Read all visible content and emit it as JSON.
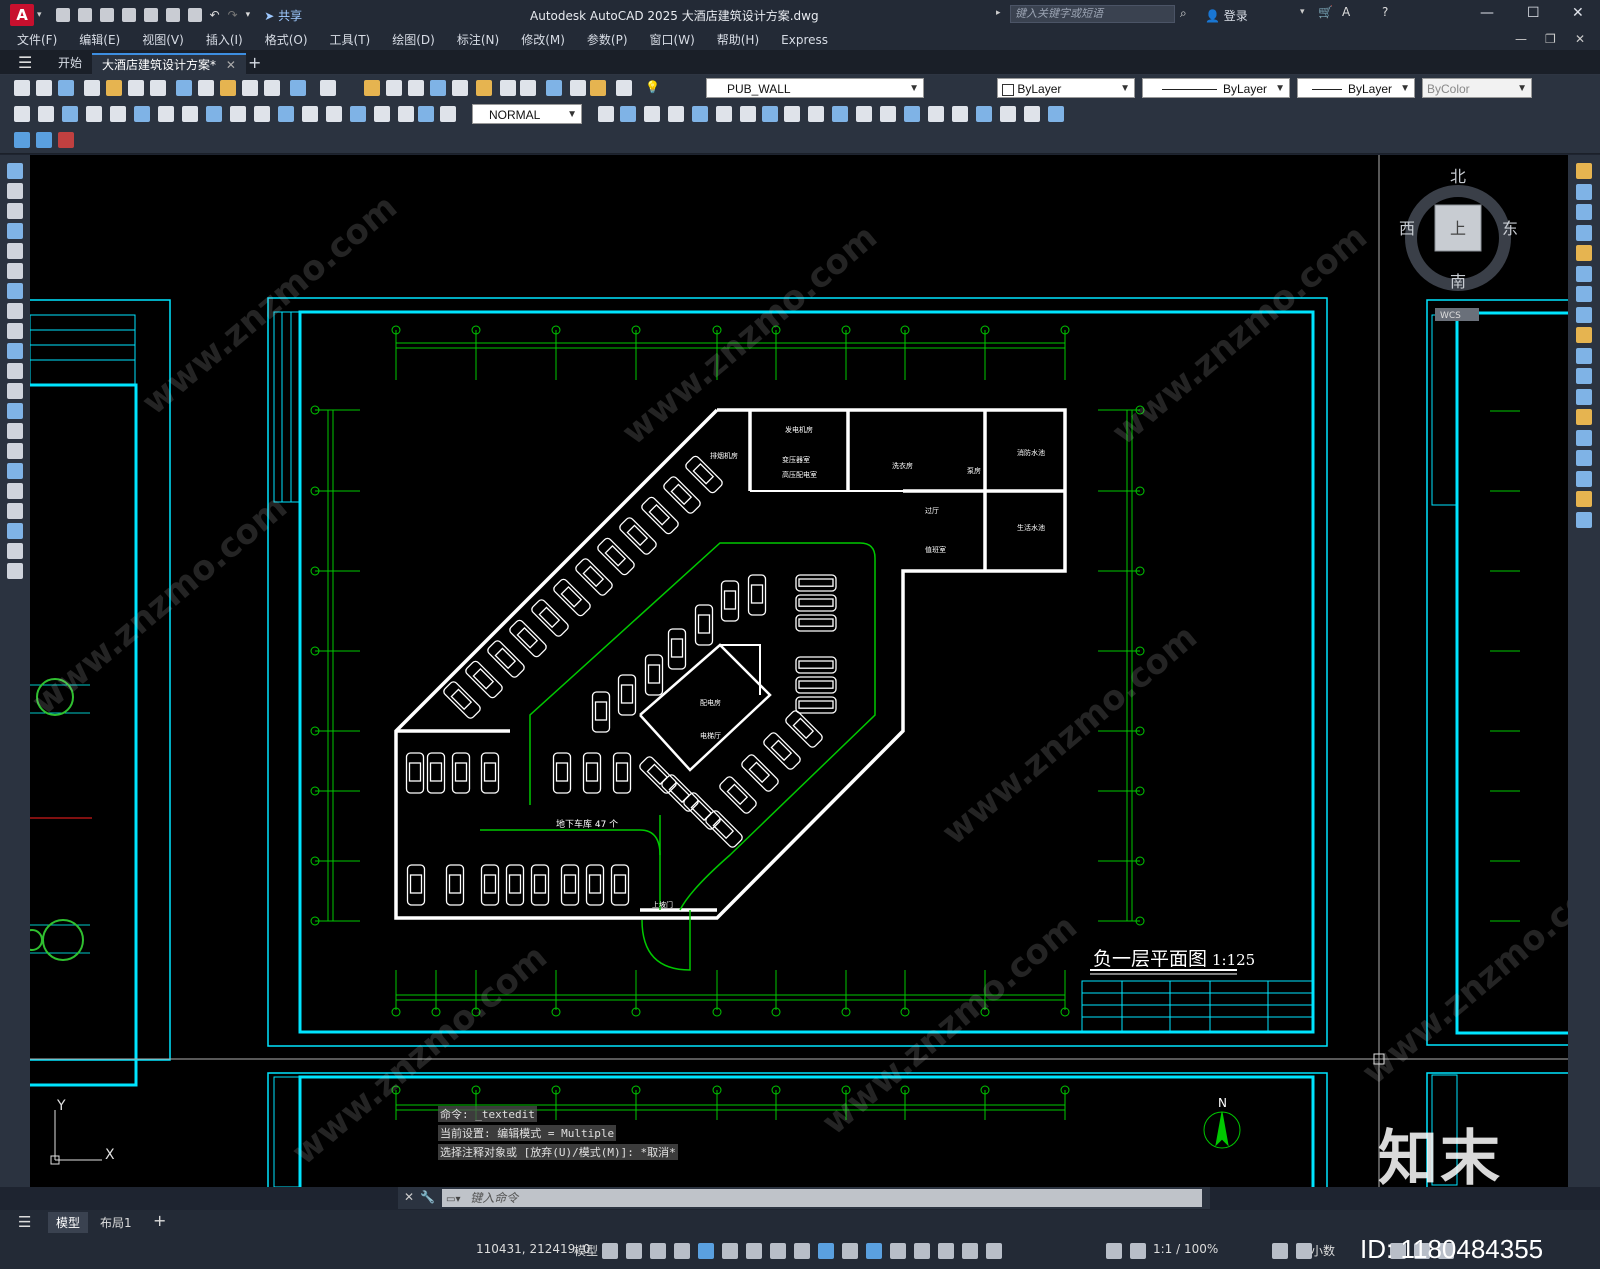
{
  "app": {
    "logo_letter": "A",
    "share_label": "共享",
    "window_title": "Autodesk AutoCAD 2025    大酒店建筑设计方案.dwg",
    "search_placeholder": "键入关键字或短语",
    "login_label": "登录"
  },
  "menu": [
    "文件(F)",
    "编辑(E)",
    "视图(V)",
    "插入(I)",
    "格式(O)",
    "工具(T)",
    "绘图(D)",
    "标注(N)",
    "修改(M)",
    "参数(P)",
    "窗口(W)",
    "帮助(H)",
    "Express"
  ],
  "tabs": {
    "start": "开始",
    "file": "大酒店建筑设计方案*",
    "add": "+"
  },
  "toolbar": {
    "layer_name": "PUB_WALL",
    "color": "ByLayer",
    "linetype": "ByLayer",
    "lineweight": "ByLayer",
    "plotstyle": "ByColor",
    "dimstyle": "NORMAL"
  },
  "viewcube": {
    "north": "北",
    "south": "南",
    "east": "东",
    "west": "西",
    "top": "上",
    "ucs": "WCS"
  },
  "drawing": {
    "title": "负一层平面图",
    "scale": "1:125",
    "parking_label": "地下车库 47 个",
    "rooms": [
      "发电机房",
      "变压器室",
      "高压配电室",
      "消防水池",
      "生活水池",
      "洗衣房",
      "配电房",
      "电梯厅",
      "过厅",
      "值班室",
      "排烟机房",
      "泵房",
      "上坡门"
    ],
    "colors": {
      "frame": "#00e5ff",
      "grid": "#00c800",
      "wall": "#ffffff",
      "red": "#ff2020"
    }
  },
  "command": {
    "line1": "命令: _textedit",
    "line2": "当前设置: 编辑模式 = Multiple",
    "line3": "选择注释对象或 [放弃(U)/模式(M)]: *取消*",
    "placeholder": "键入命令"
  },
  "layout_tabs": {
    "model": "模型",
    "layout1": "布局1",
    "add": "+"
  },
  "status": {
    "coords": "110431, 212419, 0",
    "model": "模型",
    "scale": "1:1 / 100%",
    "units": "小数"
  },
  "watermark": {
    "brand": "知末",
    "id": "ID: 1180484355",
    "site": "www.znzmo.com"
  }
}
